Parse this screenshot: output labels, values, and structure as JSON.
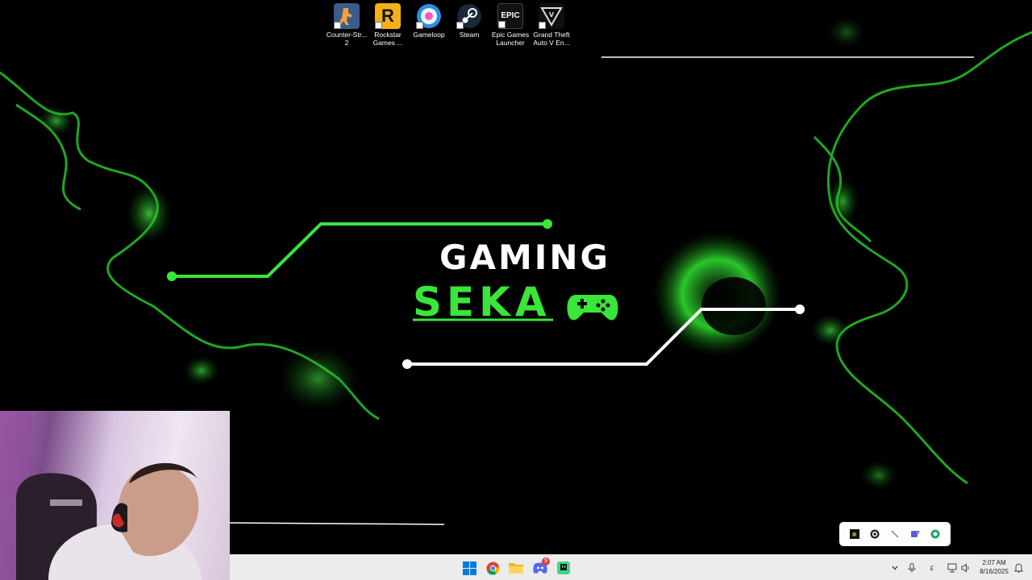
{
  "desktop": {
    "icons": [
      {
        "label": "Counter-Str... 2",
        "icon": "counter-strike-2-icon",
        "color": "#3b5b8c"
      },
      {
        "label": "Rockstar Games ...",
        "icon": "rockstar-games-icon",
        "color": "#f4b016"
      },
      {
        "label": "Gameloop",
        "icon": "gameloop-icon",
        "color": "#2d8fe0"
      },
      {
        "label": "Steam",
        "icon": "steam-icon",
        "color": "#1b2838"
      },
      {
        "label": "Epic Games Launcher",
        "icon": "epic-games-icon",
        "color": "#111111"
      },
      {
        "label": "Grand Theft Auto V En...",
        "icon": "gta-v-icon",
        "color": "#0f0f0f"
      }
    ],
    "rockstar_glyph": "R",
    "epic_glyph": "EPIC",
    "wallpaper": {
      "title_line1": "GAMING",
      "title_line2": "SEKA",
      "accent_color": "#39e639",
      "controller_icon": "gamepad-icon"
    }
  },
  "tray_flyout": {
    "icons": [
      "nvidia-icon",
      "steelseries-icon",
      "pen-icon",
      "teams-icon",
      "edge-update-icon"
    ]
  },
  "taskbar": {
    "apps": [
      "windows-start-icon",
      "chrome-icon",
      "file-explorer-icon",
      "discord-icon",
      "twitch-studio-icon"
    ],
    "discord_badge": "9",
    "clock_time": "2:07 AM",
    "clock_date": "8/16/2025",
    "language_indicator": "£"
  }
}
